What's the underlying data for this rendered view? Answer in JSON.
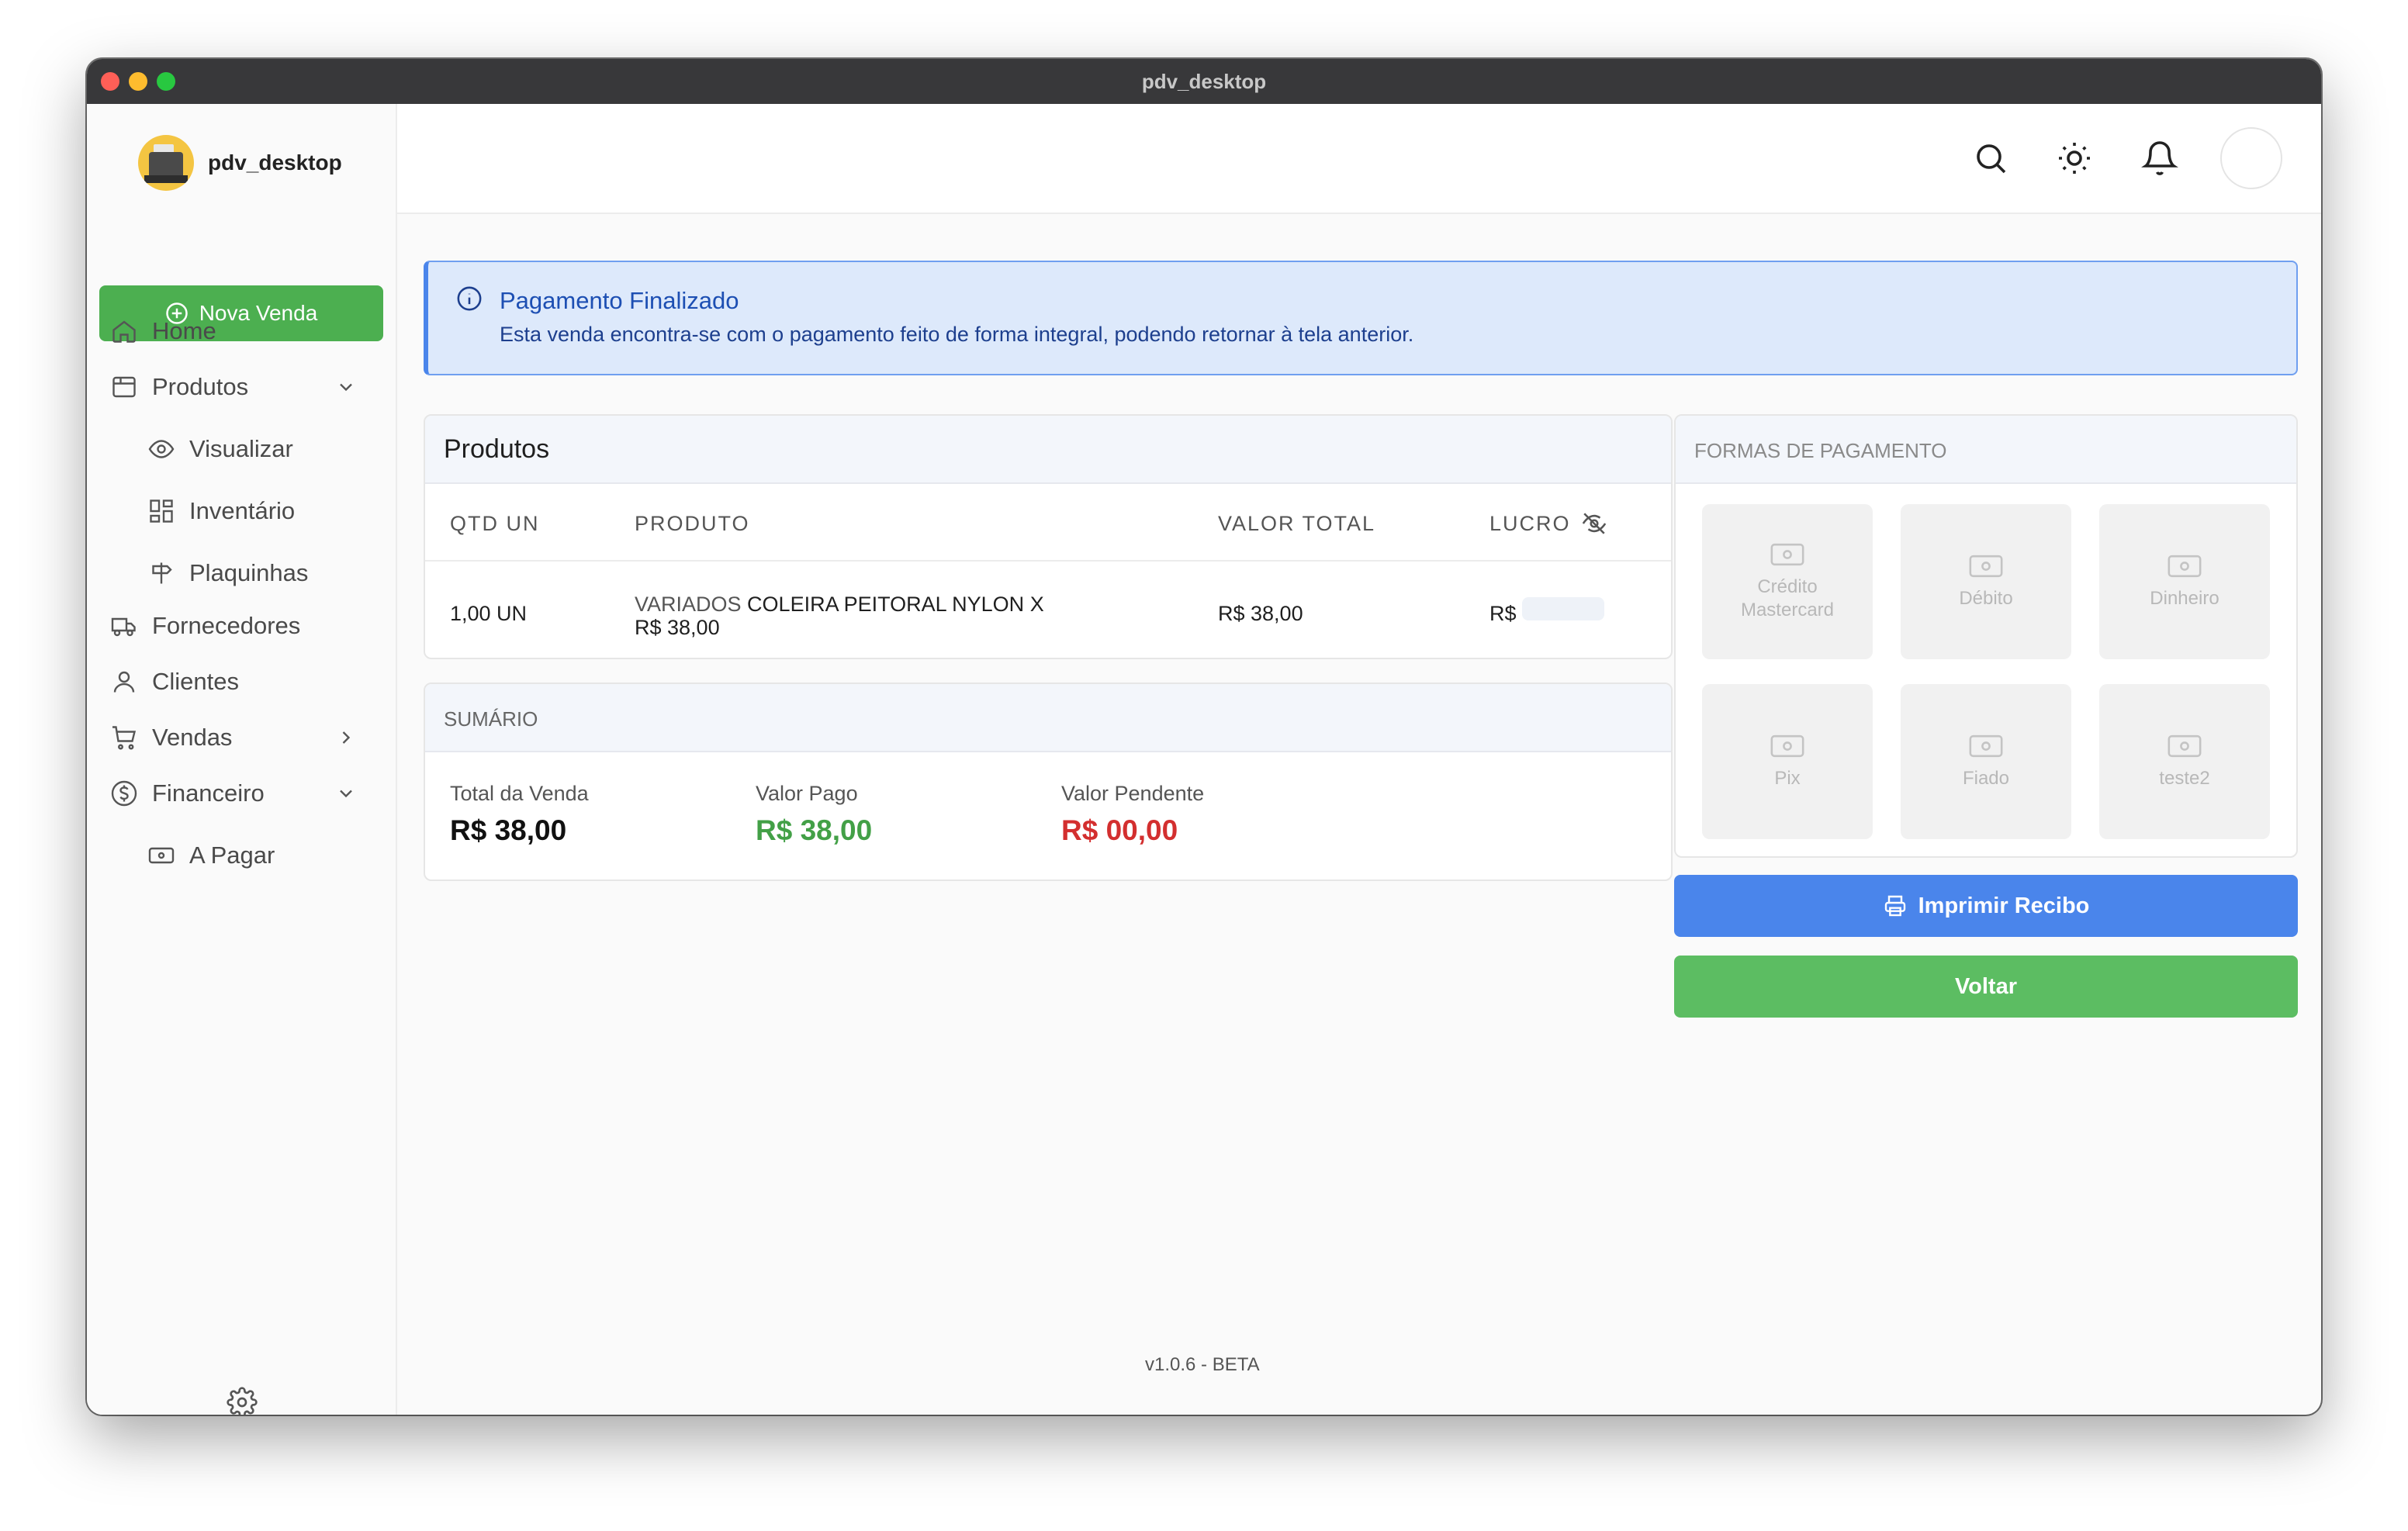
{
  "window": {
    "title": "pdv_desktop"
  },
  "brand": {
    "name": "pdv_desktop"
  },
  "sidebar": {
    "new_sale": "Nova Venda",
    "items": [
      {
        "label": "Home"
      },
      {
        "label": "Produtos"
      },
      {
        "label": "Visualizar"
      },
      {
        "label": "Inventário"
      },
      {
        "label": "Plaquinhas"
      },
      {
        "label": "Fornecedores"
      },
      {
        "label": "Clientes"
      },
      {
        "label": "Vendas"
      },
      {
        "label": "Financeiro"
      },
      {
        "label": "A Pagar"
      }
    ]
  },
  "alert": {
    "title": "Pagamento Finalizado",
    "message": "Esta venda encontra-se com o pagamento feito de forma integral, podendo retornar à tela anterior."
  },
  "products": {
    "title": "Produtos",
    "columns": [
      "QTD UN",
      "PRODUTO",
      "VALOR TOTAL",
      "LUCRO"
    ],
    "rows": [
      {
        "qty": "1,00 UN",
        "category": "VARIADOS",
        "name": "COLEIRA PEITORAL NYLON",
        "unit": "X R$ 38,00",
        "total": "R$ 38,00",
        "profit_prefix": "R$"
      }
    ]
  },
  "summary": {
    "title": "SUMÁRIO",
    "total_label": "Total da Venda",
    "total_value": "R$ 38,00",
    "paid_label": "Valor Pago",
    "paid_value": "R$ 38,00",
    "pending_label": "Valor Pendente",
    "pending_value": "R$ 00,00"
  },
  "payments": {
    "title": "FORMAS DE PAGAMENTO",
    "methods": [
      {
        "label": "Crédito Mastercard"
      },
      {
        "label": "Débito"
      },
      {
        "label": "Dinheiro"
      },
      {
        "label": "Pix"
      },
      {
        "label": "Fiado"
      },
      {
        "label": "teste2"
      }
    ]
  },
  "actions": {
    "print": "Imprimir Recibo",
    "back": "Voltar"
  },
  "footer": {
    "version": "v1.0.6 - BETA"
  },
  "colors": {
    "accent_blue": "#4a85eb",
    "green": "#4caf50",
    "paid": "#43a047",
    "pending": "#d32f2f"
  }
}
